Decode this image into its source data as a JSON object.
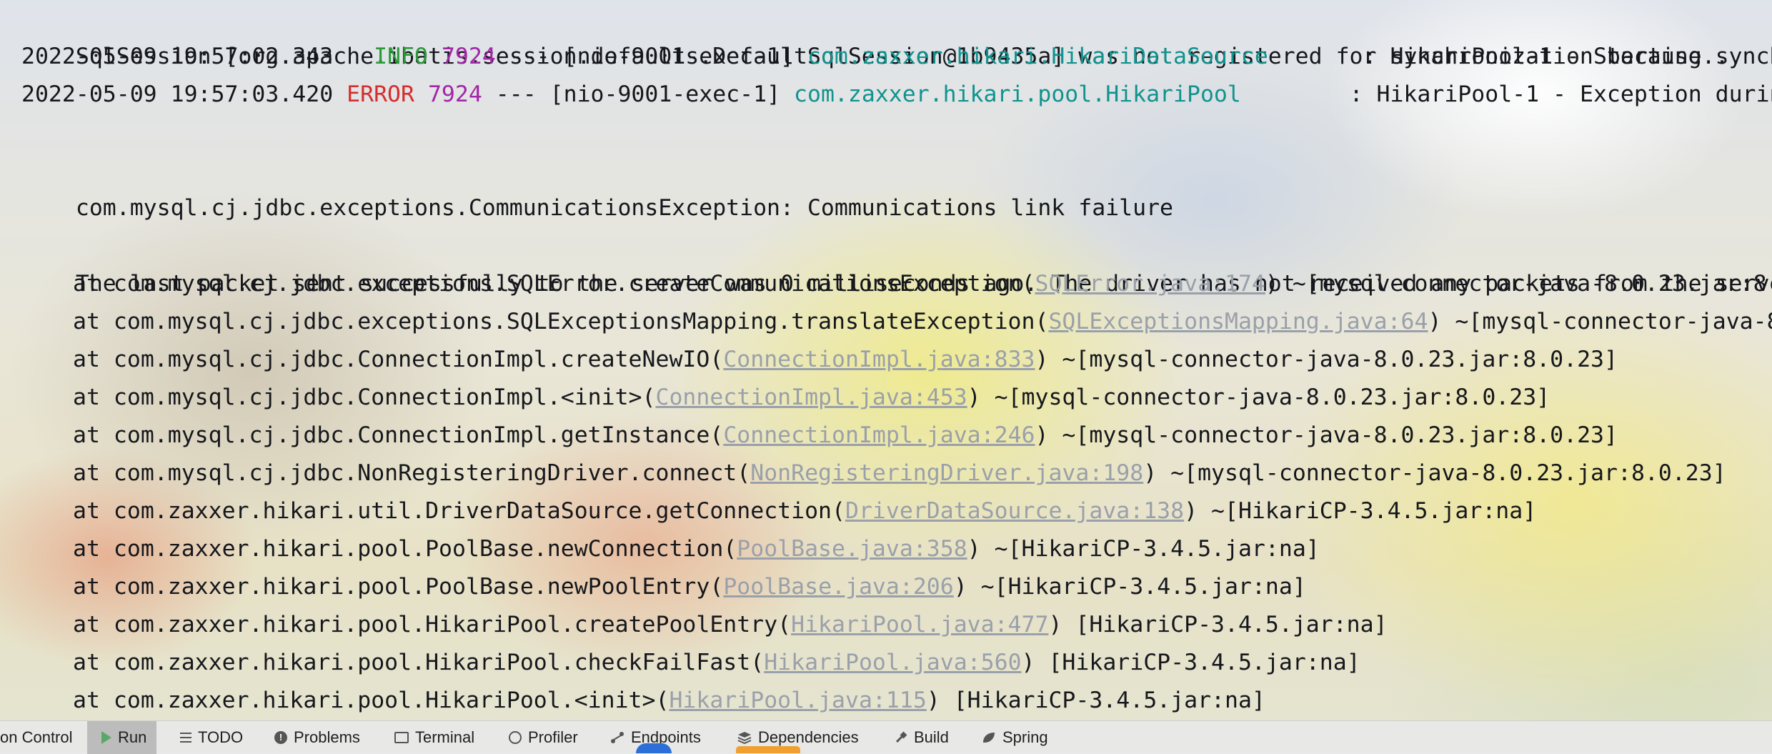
{
  "console": {
    "lines": [
      {
        "type": "plain",
        "text": "SqlSession [org.apache.ibatis.session.defaults.DefaultSqlSession@1b9435a] was not registered for synchronization because synchroni"
      },
      {
        "type": "log",
        "timestamp": "2022-05-09 19:57:02.343",
        "level": "INFO",
        "level_pad": " ",
        "pid": "7924",
        "sep": " --- ",
        "thread": "[nio-9001-exec-1]",
        "logger": "com.zaxxer.hikari.HikariDataSource",
        "gap": "       ",
        "message": ": HikariPool-1 - Starting..."
      },
      {
        "type": "log",
        "timestamp": "2022-05-09 19:57:03.420",
        "level": "ERROR",
        "level_pad": "",
        "pid": "7924",
        "sep": " --- ",
        "thread": "[nio-9001-exec-1]",
        "logger": "com.zaxxer.hikari.pool.HikariPool",
        "gap": "        ",
        "message": ": HikariPool-1 - Exception durin"
      },
      {
        "type": "plain",
        "text": ""
      },
      {
        "type": "plain",
        "text": "com.mysql.cj.jdbc.exceptions.CommunicationsException: Communications link failure"
      },
      {
        "type": "plain",
        "text": ""
      },
      {
        "type": "plain",
        "text": "The last packet sent successfully to the server was 0 milliseconds ago. The driver has not received any packets from the server."
      },
      {
        "type": "stack",
        "prefix": "at com.mysql.cj.jdbc.exceptions.SQLError.createCommunicationsException(",
        "link": "SQLError.java:174",
        "suffix": ") ~[mysql-connector-java-8.0.23.jar:8."
      },
      {
        "type": "stack",
        "prefix": "at com.mysql.cj.jdbc.exceptions.SQLExceptionsMapping.translateException(",
        "link": "SQLExceptionsMapping.java:64",
        "suffix": ") ~[mysql-connector-java-8"
      },
      {
        "type": "stack",
        "prefix": "at com.mysql.cj.jdbc.ConnectionImpl.createNewIO(",
        "link": "ConnectionImpl.java:833",
        "suffix": ") ~[mysql-connector-java-8.0.23.jar:8.0.23]"
      },
      {
        "type": "stack",
        "prefix": "at com.mysql.cj.jdbc.ConnectionImpl.<init>(",
        "link": "ConnectionImpl.java:453",
        "suffix": ") ~[mysql-connector-java-8.0.23.jar:8.0.23]"
      },
      {
        "type": "stack",
        "prefix": "at com.mysql.cj.jdbc.ConnectionImpl.getInstance(",
        "link": "ConnectionImpl.java:246",
        "suffix": ") ~[mysql-connector-java-8.0.23.jar:8.0.23]"
      },
      {
        "type": "stack",
        "prefix": "at com.mysql.cj.jdbc.NonRegisteringDriver.connect(",
        "link": "NonRegisteringDriver.java:198",
        "suffix": ") ~[mysql-connector-java-8.0.23.jar:8.0.23]"
      },
      {
        "type": "stack",
        "prefix": "at com.zaxxer.hikari.util.DriverDataSource.getConnection(",
        "link": "DriverDataSource.java:138",
        "suffix": ") ~[HikariCP-3.4.5.jar:na]"
      },
      {
        "type": "stack",
        "prefix": "at com.zaxxer.hikari.pool.PoolBase.newConnection(",
        "link": "PoolBase.java:358",
        "suffix": ") ~[HikariCP-3.4.5.jar:na]"
      },
      {
        "type": "stack",
        "prefix": "at com.zaxxer.hikari.pool.PoolBase.newPoolEntry(",
        "link": "PoolBase.java:206",
        "suffix": ") ~[HikariCP-3.4.5.jar:na]"
      },
      {
        "type": "stack",
        "prefix": "at com.zaxxer.hikari.pool.HikariPool.createPoolEntry(",
        "link": "HikariPool.java:477",
        "suffix": ") [HikariCP-3.4.5.jar:na]"
      },
      {
        "type": "stack",
        "prefix": "at com.zaxxer.hikari.pool.HikariPool.checkFailFast(",
        "link": "HikariPool.java:560",
        "suffix": ") [HikariCP-3.4.5.jar:na]"
      },
      {
        "type": "stack",
        "prefix": "at com.zaxxer.hikari.pool.HikariPool.<init>(",
        "link": "HikariPool.java:115",
        "suffix": ") [HikariCP-3.4.5.jar:na]"
      }
    ]
  },
  "toolbar": {
    "items": [
      {
        "label": "on Control",
        "icon": "none"
      },
      {
        "label": "Run",
        "icon": "run-icon"
      },
      {
        "label": "TODO",
        "icon": "list-icon"
      },
      {
        "label": "Problems",
        "icon": "problems-icon"
      },
      {
        "label": "Terminal",
        "icon": "terminal-icon"
      },
      {
        "label": "Profiler",
        "icon": "profiler-icon"
      },
      {
        "label": "Endpoints",
        "icon": "endpoints-icon"
      },
      {
        "label": "Dependencies",
        "icon": "dependencies-icon"
      },
      {
        "label": "Build",
        "icon": "build-icon"
      },
      {
        "label": "Spring",
        "icon": "spring-icon"
      }
    ]
  },
  "colors": {
    "info": "#2a9a38",
    "error": "#d42e2e",
    "pid": "#a327a8",
    "logger": "#10938e",
    "link": "#9aa0aa",
    "run_icon": "#59a869"
  }
}
